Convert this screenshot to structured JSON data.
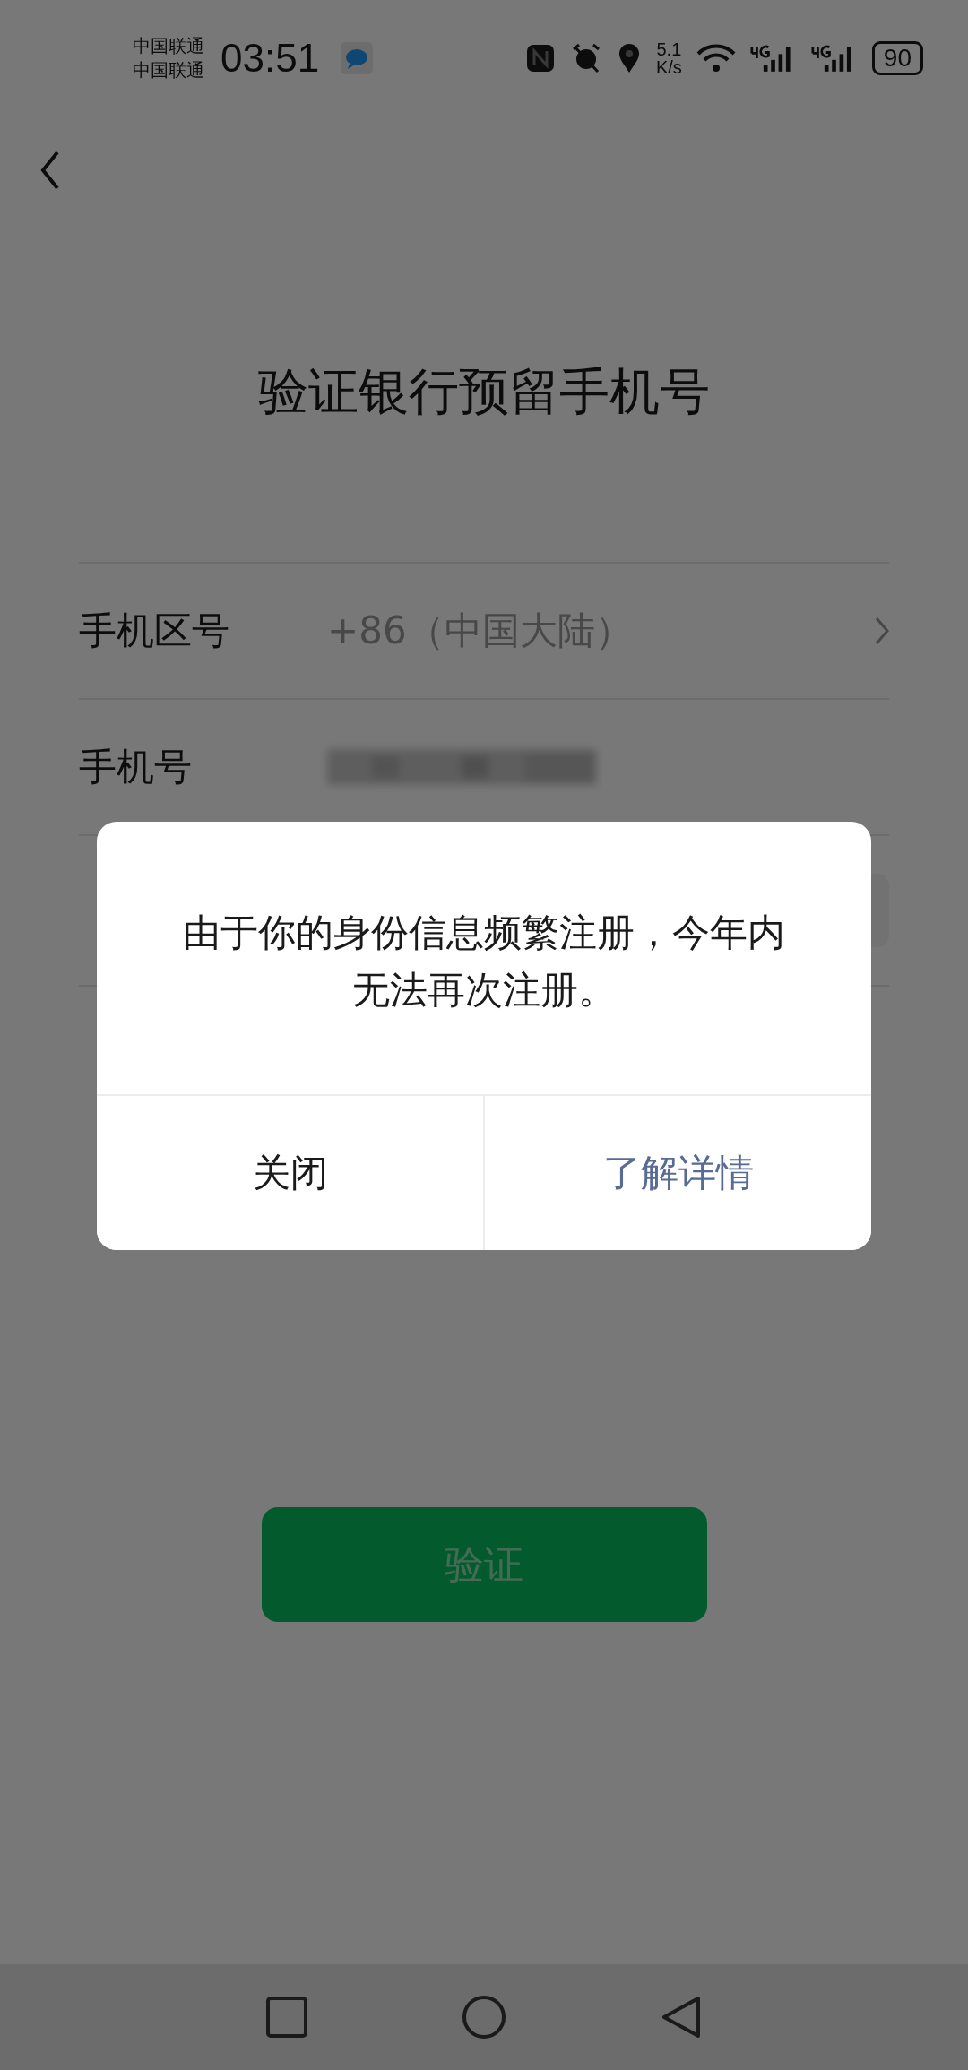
{
  "status_bar": {
    "carriers": [
      "中国联通",
      "中国联通"
    ],
    "time": "03:51",
    "net_speed": [
      "5.1",
      "K/s"
    ],
    "battery": "90"
  },
  "title": "验证银行预留手机号",
  "form": {
    "rows": [
      {
        "kind": "select",
        "label": "手机区号",
        "value": "+86（中国大陆）"
      },
      {
        "kind": "redacted",
        "label": "手机号"
      },
      {
        "kind": "input"
      }
    ]
  },
  "verify_button": {
    "label": "验证",
    "disabled": true
  },
  "dialog": {
    "message": "由于你的身份信息频繁注册，今年内无法再次注册。",
    "buttons": [
      {
        "label": "关闭",
        "kind": "secondary"
      },
      {
        "label": "了解详情",
        "kind": "primary"
      }
    ]
  }
}
